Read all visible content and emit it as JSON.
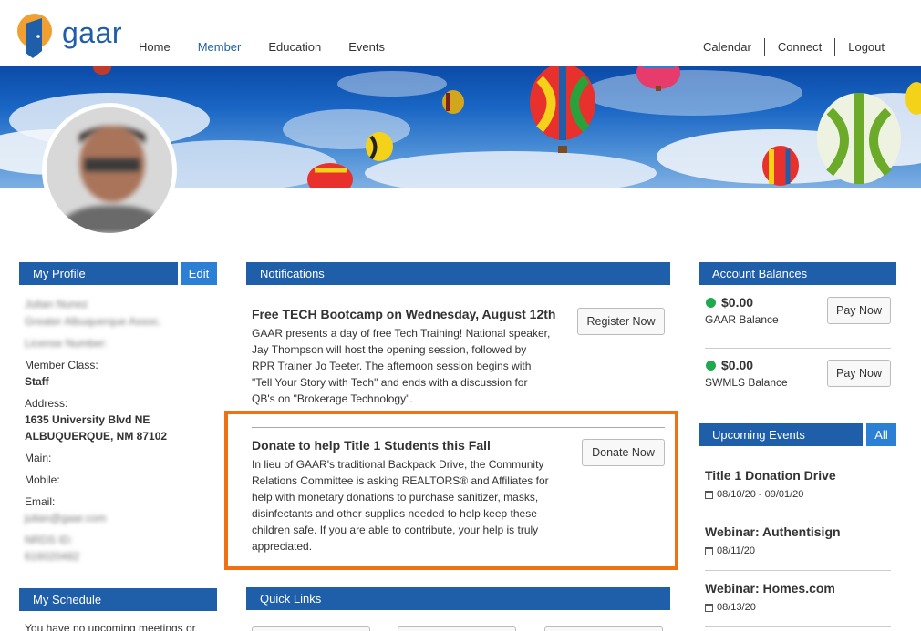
{
  "header": {
    "logo_text": "gaar",
    "nav": [
      "Home",
      "Member",
      "Education",
      "Events"
    ],
    "utility": [
      "Calendar",
      "Connect",
      "Logout"
    ]
  },
  "profile": {
    "heading": "My Profile",
    "edit_label": "Edit",
    "name": "Julian Nunez",
    "org": "Greater Albuquerque Assoc.",
    "license_label": "License Number:",
    "member_class_label": "Member Class:",
    "member_class": "Staff",
    "address_label": "Address:",
    "address_line1": "1635 University Blvd NE",
    "address_line2": "ALBUQUERQUE, NM 87102",
    "main_label": "Main:",
    "mobile_label": "Mobile:",
    "email_label": "Email:",
    "email": "julian@gaar.com",
    "nrds_label": "NRDS ID:",
    "nrds": "616020482"
  },
  "schedule": {
    "heading": "My Schedule",
    "text": "You have no upcoming meetings or"
  },
  "notifications": {
    "heading": "Notifications",
    "items": [
      {
        "title": "Free TECH Bootcamp on Wednesday, August 12th",
        "lines": [
          "GAAR presents a day of free Tech Training! National speaker,",
          "Jay Thompson will host the opening session, followed by",
          "RPR Trainer Jo Teeter. The afternoon session begins with",
          "\"Tell Your Story with Tech\" and ends with a discussion for",
          "QB's on \"Brokerage Technology\"."
        ],
        "button": "Register Now"
      },
      {
        "title": "Donate to help Title 1 Students this Fall",
        "lines": [
          "In lieu of GAAR's traditional Backpack Drive, the Community",
          "Relations Committee is asking REALTORS® and Affiliates for",
          "help with monetary donations to purchase sanitizer, masks,",
          "disinfectants and other supplies needed to help keep these",
          "children safe. If you are able to contribute, your help is truly",
          "appreciated."
        ],
        "button": "Donate Now"
      }
    ]
  },
  "quick_links": {
    "heading": "Quick Links"
  },
  "accounts": {
    "heading": "Account Balances",
    "items": [
      {
        "amount": "$0.00",
        "label": "GAAR Balance",
        "button": "Pay Now"
      },
      {
        "amount": "$0.00",
        "label": "SWMLS Balance",
        "button": "Pay Now"
      }
    ],
    "status_color": "#1faa4f"
  },
  "events": {
    "heading": "Upcoming Events",
    "all_label": "All",
    "items": [
      {
        "title": "Title 1 Donation Drive",
        "date": "08/10/20 - 09/01/20"
      },
      {
        "title": "Webinar: Authentisign",
        "date": "08/11/20"
      },
      {
        "title": "Webinar: Homes.com",
        "date": "08/13/20"
      }
    ]
  },
  "colors": {
    "brand": "#1f5ea8",
    "accent": "#2b7fd4",
    "highlight": "#f07114"
  }
}
